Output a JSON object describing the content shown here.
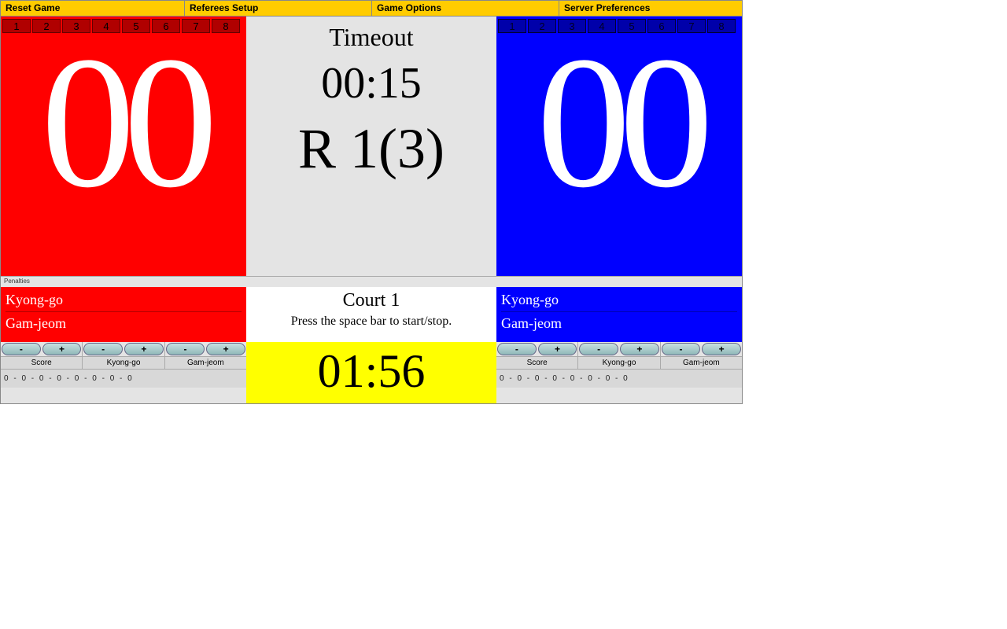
{
  "menu": {
    "reset": "Reset Game",
    "referees": "Referees Setup",
    "options": "Game Options",
    "server": "Server Preferences"
  },
  "chips": [
    "1",
    "2",
    "3",
    "4",
    "5",
    "6",
    "7",
    "8"
  ],
  "red": {
    "score": "00",
    "kyong": "Kyong-go",
    "gam": "Gam-jeom"
  },
  "blue": {
    "score": "00",
    "kyong": "Kyong-go",
    "gam": "Gam-jeom"
  },
  "center": {
    "timeout_label": "Timeout",
    "timeout_time": "00:15",
    "round": "R 1(3)",
    "court": "Court 1",
    "hint": "Press the space bar to start/stop.",
    "main_timer": "01:56"
  },
  "controls": {
    "minus": "-",
    "plus": "+",
    "score_label": "Score",
    "kyong_label": "Kyong-go",
    "gam_label": "Gam-jeom",
    "stats": "0 -   0 -   0 -   0 -   0 -   0 -   0 -   0"
  },
  "small_label": "Penalties"
}
